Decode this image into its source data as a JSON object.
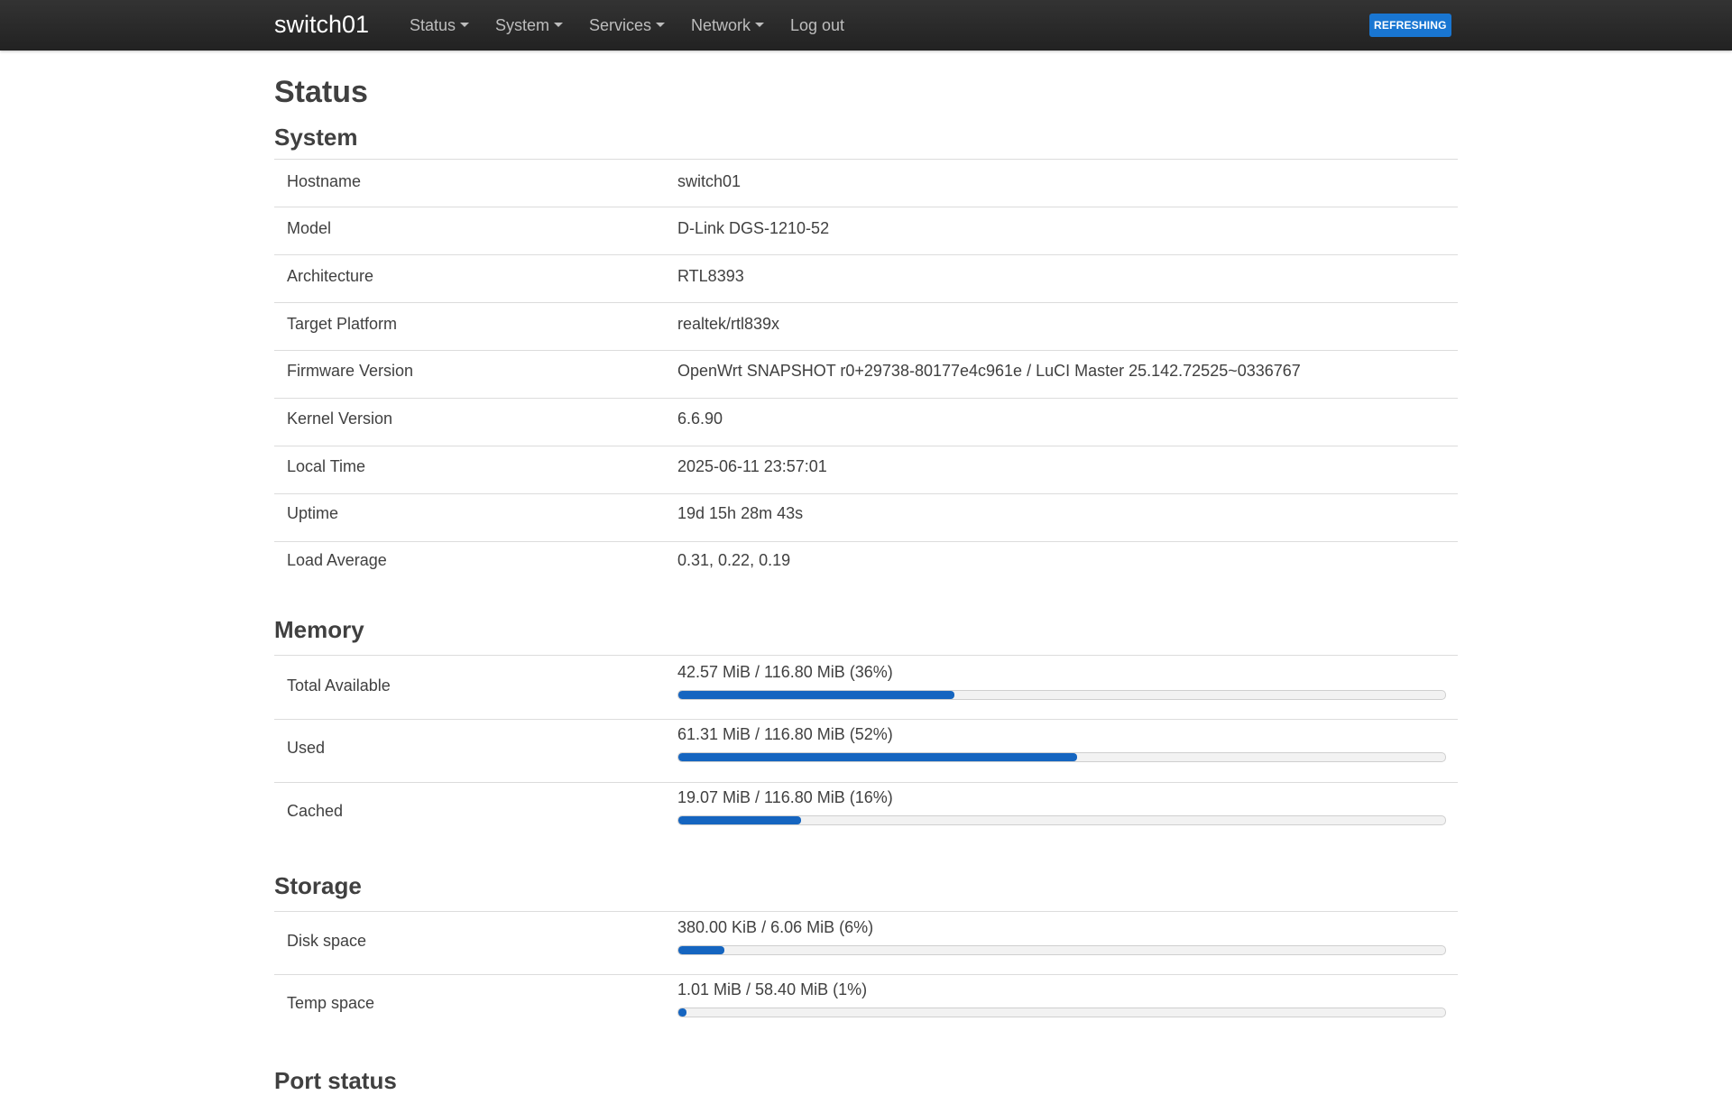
{
  "navbar": {
    "brand": "switch01",
    "menu": [
      {
        "label": "Status",
        "has_dropdown": true
      },
      {
        "label": "System",
        "has_dropdown": true
      },
      {
        "label": "Services",
        "has_dropdown": true
      },
      {
        "label": "Network",
        "has_dropdown": true
      },
      {
        "label": "Log out",
        "has_dropdown": false
      }
    ],
    "indicator": "REFRESHING"
  },
  "page": {
    "title": "Status",
    "system": {
      "heading": "System",
      "rows": [
        {
          "label": "Hostname",
          "value": "switch01"
        },
        {
          "label": "Model",
          "value": "D-Link DGS-1210-52"
        },
        {
          "label": "Architecture",
          "value": "RTL8393"
        },
        {
          "label": "Target Platform",
          "value": "realtek/rtl839x"
        },
        {
          "label": "Firmware Version",
          "value": "OpenWrt SNAPSHOT r0+29738-80177e4c961e / LuCI Master 25.142.72525~0336767"
        },
        {
          "label": "Kernel Version",
          "value": "6.6.90"
        },
        {
          "label": "Local Time",
          "value": "2025-06-11 23:57:01"
        },
        {
          "label": "Uptime",
          "value": "19d 15h 28m 43s"
        },
        {
          "label": "Load Average",
          "value": "0.31, 0.22, 0.19"
        }
      ]
    },
    "memory": {
      "heading": "Memory",
      "rows": [
        {
          "label": "Total Available",
          "text": "42.57 MiB / 116.80 MiB (36%)",
          "percent": 36
        },
        {
          "label": "Used",
          "text": "61.31 MiB / 116.80 MiB (52%)",
          "percent": 52
        },
        {
          "label": "Cached",
          "text": "19.07 MiB / 116.80 MiB (16%)",
          "percent": 16
        }
      ]
    },
    "storage": {
      "heading": "Storage",
      "rows": [
        {
          "label": "Disk space",
          "text": "380.00 KiB / 6.06 MiB (6%)",
          "percent": 6
        },
        {
          "label": "Temp space",
          "text": "1.01 MiB / 58.40 MiB (1%)",
          "percent": 1
        }
      ]
    },
    "port_status": {
      "heading": "Port status"
    }
  },
  "colors": {
    "accent": "#1565c0",
    "badge": "#1976d2",
    "navbar": "#2b2b2b"
  }
}
